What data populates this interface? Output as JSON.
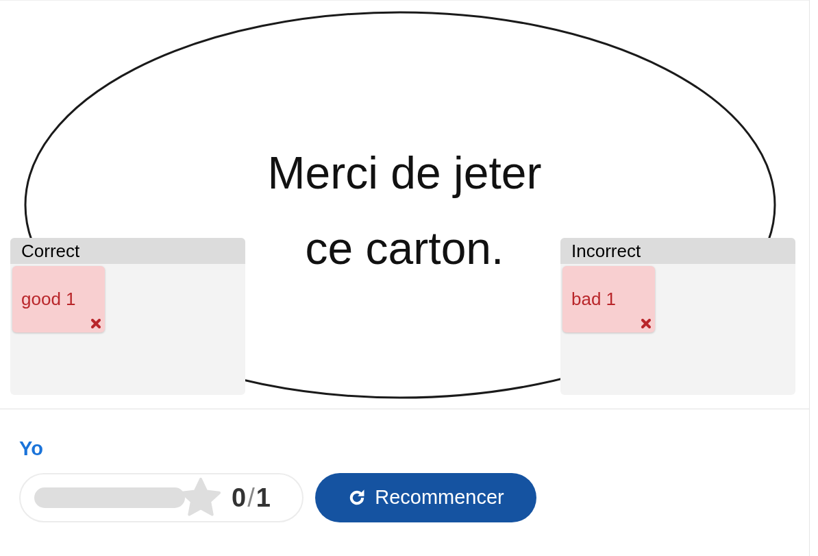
{
  "background": {
    "lines": [
      "Merci de jeter",
      "ce carton."
    ]
  },
  "dropzones": [
    {
      "label": "Correct",
      "items": [
        {
          "text": "good 1",
          "correct": false
        }
      ]
    },
    {
      "label": "Incorrect",
      "items": [
        {
          "text": "bad 1",
          "correct": false
        }
      ]
    }
  ],
  "task_title": "Yo",
  "score": {
    "level": 0,
    "score": "0",
    "separator": "/",
    "max": "1"
  },
  "retry_button": "Recommencer"
}
